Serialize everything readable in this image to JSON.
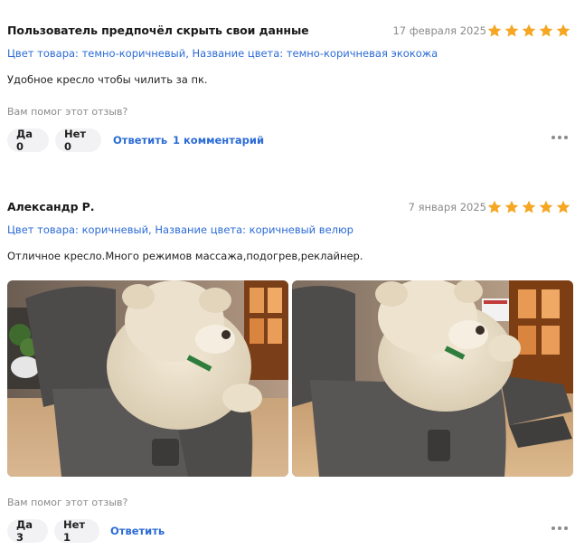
{
  "reviews": [
    {
      "author": "Пользователь предпочёл скрыть свои данные",
      "date": "17 февраля 2025",
      "rating": 5,
      "attributes": "Цвет товара: темно-коричневый, Название цвета: темно-коричневая экокожа",
      "text": "Удобное кресло чтобы чилить за пк.",
      "helpful_question": "Вам помог этот отзыв?",
      "yes_label": "Да 0",
      "no_label": "Нет 0",
      "reply_label": "Ответить",
      "comments_label": "1 комментарий"
    },
    {
      "author": "Александр Р.",
      "date": "7 января 2025",
      "rating": 5,
      "attributes": "Цвет товара: коричневый, Название цвета: коричневый велюр",
      "text": "Отличное кресло.Много режимов массажа,подогрев,реклайнер.",
      "photos": [
        "photo-recliner-with-teddy-bear-upright",
        "photo-recliner-with-teddy-bear-reclined"
      ],
      "helpful_question": "Вам помог этот отзыв?",
      "yes_label": "Да 3",
      "no_label": "Нет 1",
      "reply_label": "Ответить"
    }
  ],
  "colors": {
    "star": "#f5a623",
    "link": "#2b6bd6",
    "muted": "#8a8a8a",
    "button_bg": "#f2f2f4"
  },
  "icons": {
    "star": "star-icon",
    "more": "more-dots-icon"
  }
}
